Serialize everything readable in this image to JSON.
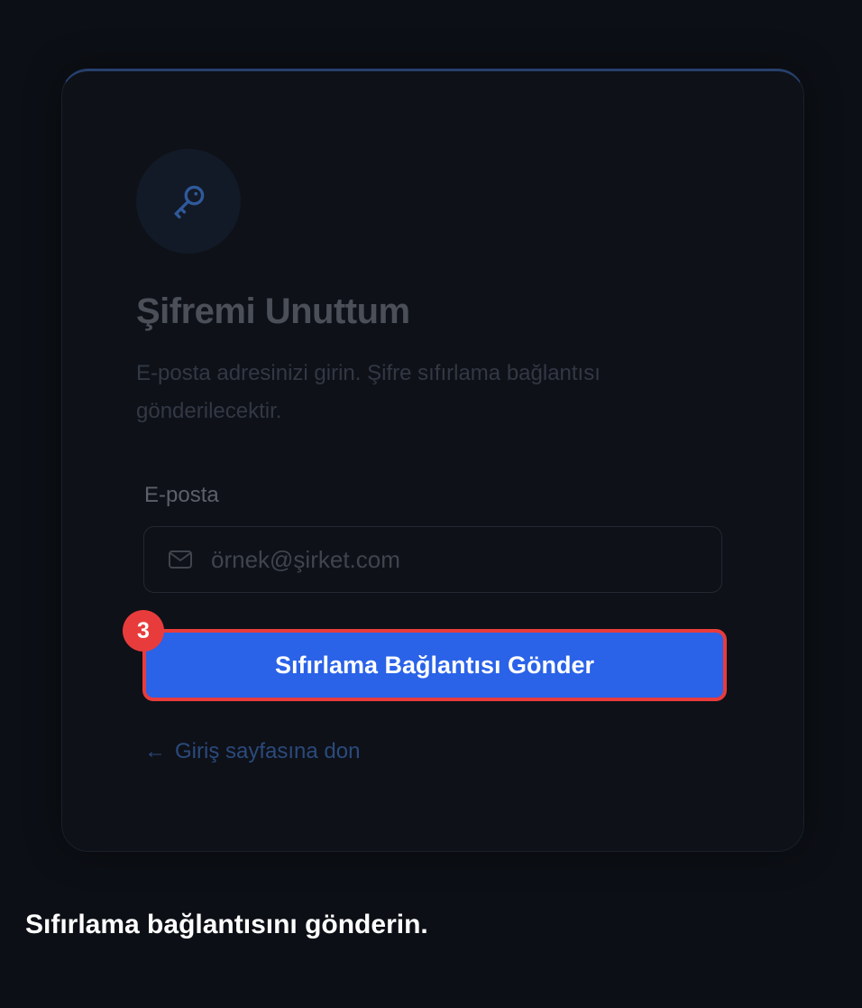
{
  "card": {
    "icon": "key-icon",
    "title": "Şifremi Unuttum",
    "subtitle": "E-posta adresinizi girin. Şifre sıfırlama bağlantısı gönderilecektir.",
    "email_label": "E-posta",
    "email_placeholder": "örnek@şirket.com",
    "email_value": "",
    "email_icon": "mail-icon",
    "submit_label": "Sıfırlama Bağlantısı Gönder",
    "back_icon": "arrow-left-icon",
    "back_label": "Giriş sayfasına don"
  },
  "annotation": {
    "step_number": "3",
    "highlight_color": "#e83c3c",
    "caption": "Sıfırlama bağlantısını gönderin."
  },
  "colors": {
    "background": "#0c0f15",
    "card_background": "#0e1118",
    "accent": "#2a62e8",
    "link": "#2b4a7c"
  }
}
